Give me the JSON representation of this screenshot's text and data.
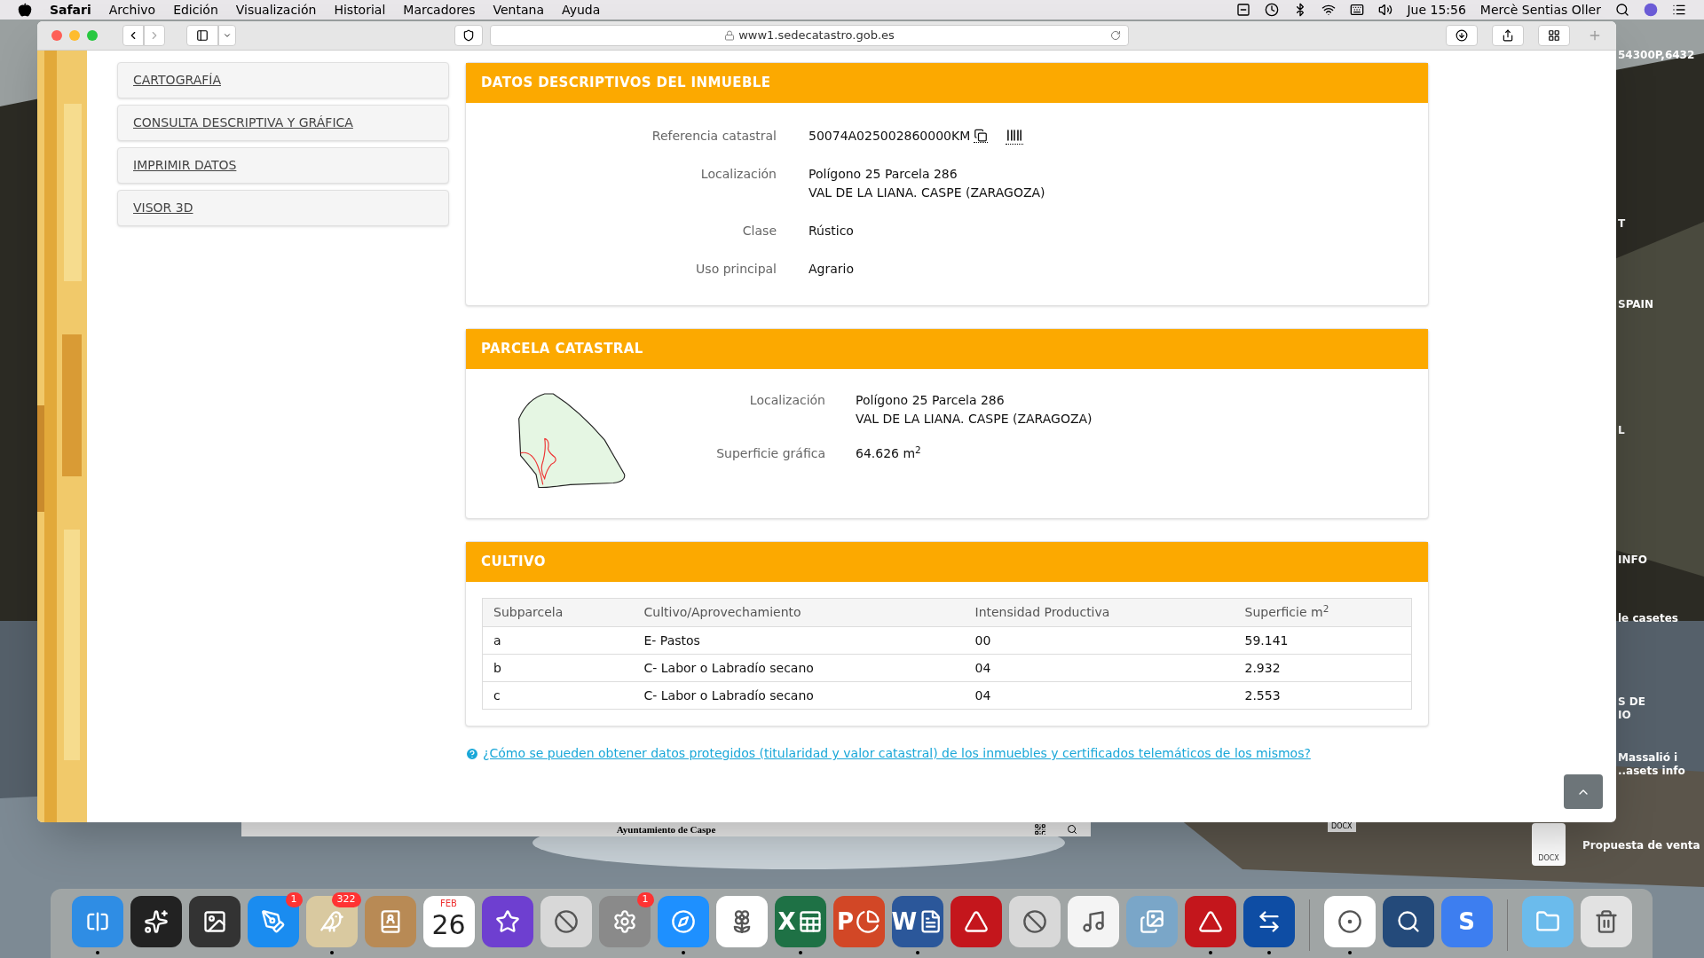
{
  "menu_bar": {
    "app": "Safari",
    "menus": [
      "Archivo",
      "Edición",
      "Visualización",
      "Historial",
      "Marcadores",
      "Ventana",
      "Ayuda"
    ],
    "clock": "Jue 15:56",
    "user": "Mercè Sentias Oller"
  },
  "browser": {
    "url": "www1.sedecatastro.gob.es"
  },
  "sidebar": {
    "items": [
      "CARTOGRAFÍA",
      "CONSULTA DESCRIPTIVA Y GRÁFICA",
      "IMPRIMIR DATOS",
      "VISOR 3D"
    ]
  },
  "descriptive": {
    "title": "DATOS DESCRIPTIVOS DEL INMUEBLE",
    "rows": [
      {
        "kind": "reference",
        "label": "Referencia catastral",
        "value": [
          "50074A025002860000KM"
        ]
      },
      {
        "kind": "text",
        "label": "Localización",
        "value": [
          "Polígono 25 Parcela 286",
          "VAL DE LA LIANA. CASPE (ZARAGOZA)"
        ]
      },
      {
        "kind": "text",
        "label": "Clase",
        "value": [
          "Rústico"
        ]
      },
      {
        "kind": "text",
        "label": "Uso principal",
        "value": [
          "Agrario"
        ]
      }
    ]
  },
  "parcel": {
    "title": "PARCELA CATASTRAL",
    "rows": [
      {
        "label": "Localización",
        "value": [
          "Polígono 25 Parcela 286",
          "VAL DE LA LIANA. CASPE (ZARAGOZA)"
        ]
      },
      {
        "label": "Superficie gráfica",
        "value": [
          "64.626 m$^{2}$"
        ]
      }
    ]
  },
  "crops": {
    "title": "CULTIVO",
    "columns": [
      "Subparcela",
      "Cultivo/Aprovechamiento",
      "Intensidad Productiva",
      "Superficie m$^{2}$"
    ],
    "rows": [
      [
        "a",
        "E- Pastos",
        "00",
        "59.141"
      ],
      [
        "b",
        "C- Labor o Labradío secano",
        "04",
        "2.932"
      ],
      [
        "c",
        "C- Labor o Labradío secano",
        "04",
        "2.553"
      ]
    ]
  },
  "help_link": "¿Cómo se pueden obtener datos protegidos (titularidad y valor catastral) de los inmuebles y certificados telemáticos de los mismos?",
  "background_window": {
    "title": "Ayuntamiento de Caspe"
  },
  "desktop": {
    "labels": [
      [
        "54300P,6432"
      ],
      [
        "T"
      ],
      [
        "SPAIN"
      ],
      [
        "L"
      ],
      [
        "INFO"
      ],
      [
        "le casetes"
      ],
      [
        "S DE",
        "IO"
      ],
      [
        "Massalió i",
        "..asets info"
      ]
    ],
    "file": {
      "type": "DOCX",
      "name": "Propuesta de venta"
    },
    "hidden_file_type": "DOCX"
  },
  "dock": [
    {
      "kind": "finder",
      "running": true
    },
    {
      "kind": "siri",
      "running": false
    },
    {
      "kind": "photobooth",
      "running": false
    },
    {
      "kind": "appstore",
      "running": false,
      "badge": "1"
    },
    {
      "kind": "mail",
      "running": true,
      "badge": "322"
    },
    {
      "kind": "contacts",
      "running": false
    },
    {
      "kind": "calendar",
      "running": false,
      "month": "FEB",
      "day": "26"
    },
    {
      "kind": "imovie",
      "running": false
    },
    {
      "kind": "blocked",
      "running": false
    },
    {
      "kind": "settings",
      "running": false,
      "badge": "1"
    },
    {
      "kind": "safari",
      "running": true
    },
    {
      "kind": "photos",
      "running": false
    },
    {
      "kind": "excel",
      "running": true,
      "letter": "X"
    },
    {
      "kind": "powerpoint",
      "running": false,
      "letter": "P"
    },
    {
      "kind": "word",
      "running": true,
      "letter": "W"
    },
    {
      "kind": "acrobat",
      "running": false
    },
    {
      "kind": "blocked",
      "running": false
    },
    {
      "kind": "music",
      "running": false
    },
    {
      "kind": "preview",
      "running": false
    },
    {
      "kind": "acrobat",
      "running": true
    },
    {
      "kind": "teamviewer",
      "running": true
    },
    {
      "kind": "separator"
    },
    {
      "kind": "chrome",
      "running": true
    },
    {
      "kind": "quicktime",
      "running": false
    },
    {
      "kind": "sapp",
      "running": false,
      "letter": "S"
    },
    {
      "kind": "separator"
    },
    {
      "kind": "folder",
      "running": false
    },
    {
      "kind": "trash",
      "running": false
    }
  ]
}
